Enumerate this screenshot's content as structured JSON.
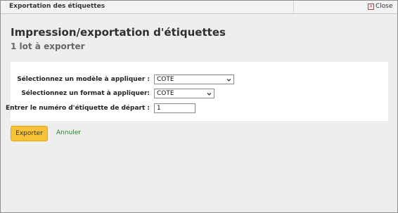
{
  "dialog": {
    "title": "Exportation des étiquettes",
    "close_label": "Close"
  },
  "heading": "Impression/exportation d'étiquettes",
  "subheading": "1 lot à exporter",
  "form": {
    "template_label": "Sélectionnez un modèle à appliquer :",
    "template_value": "COTE",
    "format_label": "Sélectionnez un format à appliquer:",
    "format_value": "COTE",
    "start_label": "Entrer le numéro d'étiquette de départ :",
    "start_value": "1"
  },
  "actions": {
    "export_label": "Exporter",
    "cancel_label": "Annuler"
  },
  "colors": {
    "export_button": "#f8c237",
    "cancel_link": "#2c7a2c",
    "close_icon": "#c23b3b"
  }
}
